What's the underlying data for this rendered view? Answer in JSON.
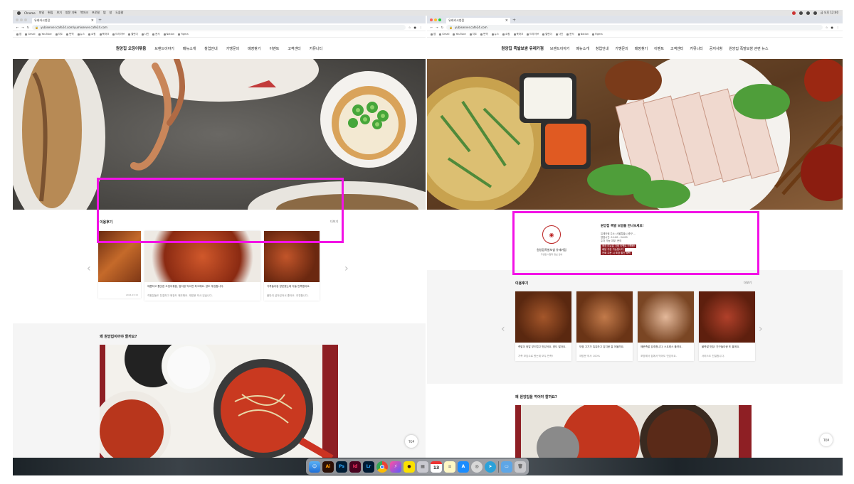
{
  "menubar": {
    "items": [
      "Chrome",
      "파일",
      "편집",
      "보기",
      "방문 기록",
      "북마크",
      "프로필",
      "탭",
      "창",
      "도움말"
    ],
    "clock": "금 오후 12:40"
  },
  "left": {
    "tab_title": "유레카시청점",
    "url": "yubiserver.cafe24.com/yumiserver.cafe24.com",
    "bookmarks": [
      "앱",
      "Gmail",
      "YouTube",
      "지도",
      "번역",
      "뉴스",
      "쇼핑",
      "북마크",
      "드라이브",
      "캘린더",
      "사진",
      "문서",
      "Notion",
      "Figma"
    ],
    "nav": {
      "brand": "원앙집 오징어볶음",
      "items": [
        "브랜드이야기",
        "메뉴소개",
        "창업안내",
        "가맹문의",
        "매장찾기",
        "이벤트",
        "고객센터",
        "커뮤니티"
      ]
    },
    "reviews": {
      "title": "이용후기",
      "more": "더보기",
      "cards": [
        {
          "text": "정말 맛있어요. 또 올게요 최고입니다.",
          "meta": "2024.03.15"
        },
        {
          "text": "매콤하고 쫄깃한 오징어볶음, 밥이랑 먹으면 최고예요. 양도 푸짐합니다.",
          "sub": "직원분들도 친절하고 매장도 깨끗해요. 재방문 의사 있습니다.",
          "meta": "2024.03.12"
        },
        {
          "text": "가족들이랑 방문했는데 다들 만족했어요.",
          "sub": "불맛이 살아있어서 좋아요. 추천합니다.",
          "meta": "2024.03.10"
        }
      ]
    },
    "why": {
      "title": "왜 원앙집이어야 할까요?"
    }
  },
  "right": {
    "tab_title": "유레카시청점",
    "url": "yubiserver.cafe24.com",
    "bookmarks": [
      "앱",
      "Gmail",
      "YouTube",
      "지도",
      "번역",
      "뉴스",
      "쇼핑",
      "북마크",
      "드라이브",
      "캘린더",
      "사진",
      "문서",
      "Notion",
      "Figma"
    ],
    "nav": {
      "brand": "원앙집 족발보쌈 유레카점",
      "items": [
        "브랜드이야기",
        "메뉴소개",
        "창업안내",
        "가맹문의",
        "매장찾기",
        "이벤트",
        "고객센터",
        "커뮤니티",
        "공지사항",
        "원앙집 족발보쌈 관련 뉴스"
      ]
    },
    "store": {
      "name": "원앙집족발보쌈 유레카점",
      "sub": "가맹점 사업자 정보 안내",
      "headline": "원앙집 족발 보쌈을 만나보세요!",
      "lines": [
        "유레카점 주소: 서울특별시 중구 ...",
        "영업시간: 11:00 - 24:00",
        "주차 가능 여부: 문의"
      ],
      "highlights": [
        "매장 리뉴얼 기념 이벤트 진행중!",
        "배달 주문 가능합니다",
        "전화 주문 시 포장 할인 혜택"
      ]
    },
    "reviews": {
      "title": "이용후기",
      "more": "더보기",
      "cards": [
        {
          "text": "족발이 정말 부드럽고 맛있어요. 양도 많아요.",
          "sub": "가족 모임으로 왔는데 모두 만족!"
        },
        {
          "text": "보쌈 고기가 촉촉하고 김치랑 잘 어울려요.",
          "sub": "재방문 의사 100%"
        },
        {
          "text": "매운족발 강추합니다. 스트레스 풀려요.",
          "sub": "포장해서 집에서 먹어도 맛있어요."
        },
        {
          "text": "불족발 맛집! 친구들이랑 또 올게요.",
          "sub": "서비스도 친절합니다."
        }
      ]
    },
    "why": {
      "title": "왜 원앙집을 먹어야 할까요?"
    }
  },
  "scroll_top_label": "TOP",
  "dock": [
    "Finder",
    "Ai",
    "Ps",
    "Id",
    "Lr",
    "Chrome",
    "Shortcuts",
    "KakaoTalk",
    "Launchpad",
    "13",
    "Notes",
    "App Store",
    "Safari",
    "Telegram",
    "Folder",
    "Trash"
  ]
}
